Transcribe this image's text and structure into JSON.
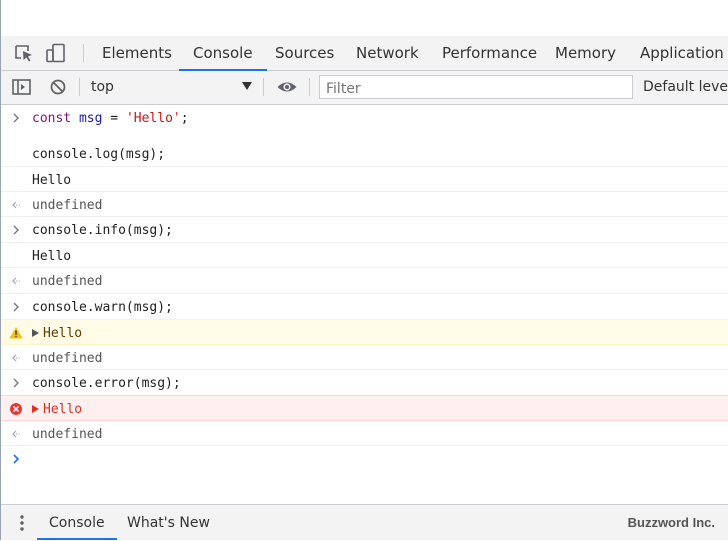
{
  "tabs": [
    {
      "label": "Elements"
    },
    {
      "label": "Console"
    },
    {
      "label": "Sources"
    },
    {
      "label": "Network"
    },
    {
      "label": "Performance"
    },
    {
      "label": "Memory"
    },
    {
      "label": "Application"
    }
  ],
  "toolbar": {
    "context": "top",
    "filter_placeholder": "Filter",
    "levels": "Default levels"
  },
  "console": {
    "input1": {
      "kw": "const",
      "var": "msg",
      "op": " = ",
      "str": "'Hello'",
      "end": ";"
    },
    "input2": "console.log(msg);",
    "out2": "Hello",
    "result2": "undefined",
    "input3": "console.info(msg);",
    "out3": "Hello",
    "result3": "undefined",
    "input4": "console.warn(msg);",
    "out4": "Hello",
    "result4": "undefined",
    "input5": "console.error(msg);",
    "out5": "Hello",
    "result5": "undefined"
  },
  "drawer": {
    "tabs": [
      {
        "label": "Console"
      },
      {
        "label": "What's New"
      }
    ],
    "brand": "Buzzword Inc."
  },
  "colors": {
    "accent": "#1a73e8",
    "warn_bg": "#fffbe6",
    "error_bg": "#fff0f0",
    "error_text": "#d93026"
  }
}
